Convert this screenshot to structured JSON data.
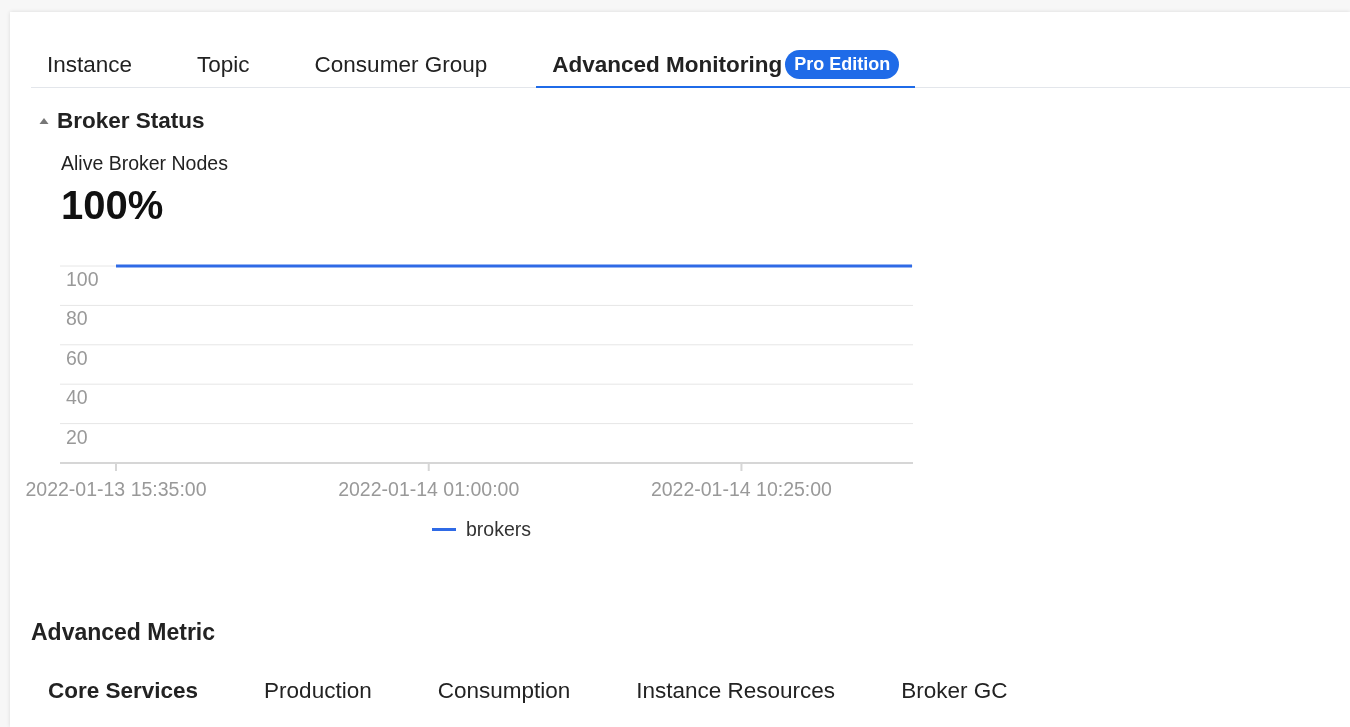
{
  "tabs": [
    {
      "label": "Instance",
      "selected": false
    },
    {
      "label": "Topic",
      "selected": false
    },
    {
      "label": "Consumer Group",
      "selected": false
    },
    {
      "label": "Advanced Monitoring",
      "selected": true,
      "badge": "Pro Edition"
    }
  ],
  "broker_status": {
    "title": "Broker Status",
    "expanded": true,
    "metric_label": "Alive Broker Nodes",
    "metric_value": "100%",
    "chart_data": {
      "type": "line",
      "grid": true,
      "ylim": [
        0,
        100
      ],
      "yticks": [
        20,
        40,
        60,
        80,
        100
      ],
      "categories": [
        "2022-01-13 15:35:00",
        null,
        null,
        null,
        null,
        null,
        null,
        null,
        null,
        null,
        null,
        "2022-01-14 01:00:00",
        null,
        null,
        null,
        null,
        null,
        null,
        null,
        null,
        null,
        null,
        "2022-01-14 10:25:00",
        null,
        null,
        null,
        null,
        null,
        null
      ],
      "series": [
        {
          "name": "brokers",
          "color": "#2f6ae6",
          "values": [
            100,
            100,
            100,
            100,
            100,
            100,
            100,
            100,
            100,
            100,
            100,
            100,
            100,
            100,
            100,
            100,
            100,
            100,
            100,
            100,
            100,
            100,
            100,
            100,
            100,
            100,
            100,
            100,
            100
          ]
        }
      ]
    }
  },
  "advanced_metric": {
    "title": "Advanced Metric",
    "tabs": [
      {
        "label": "Core Services",
        "selected": true
      },
      {
        "label": "Production",
        "selected": false
      },
      {
        "label": "Consumption",
        "selected": false
      },
      {
        "label": "Instance Resources",
        "selected": false
      },
      {
        "label": "Broker GC",
        "selected": false
      }
    ]
  }
}
